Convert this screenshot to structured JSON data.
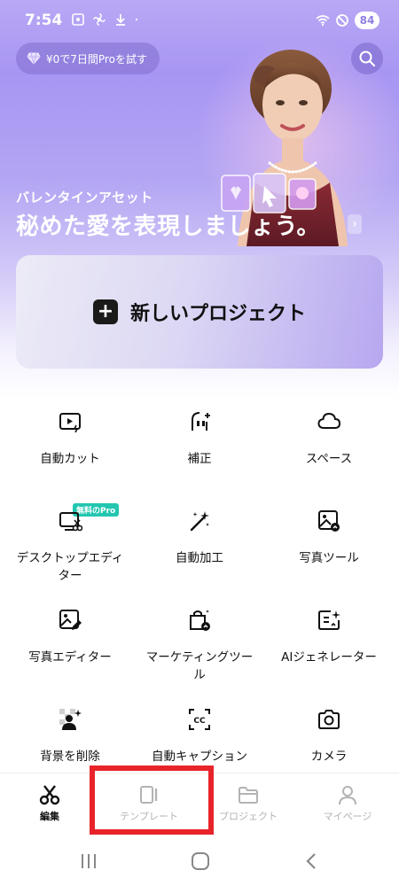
{
  "status_bar": {
    "time": "7:54",
    "battery": "84"
  },
  "promo": {
    "label": "¥0で7日間Proを試す",
    "icon": "diamond-icon"
  },
  "search": {
    "icon": "search-icon"
  },
  "hero": {
    "subtitle": "バレンタインアセット",
    "title": "秘めた愛を表現しましょう。",
    "arrow": "›"
  },
  "new_project": {
    "plus": "+",
    "label": "新しいプロジェクト"
  },
  "tools": [
    {
      "label": "自動カット",
      "icon": "video-auto-icon"
    },
    {
      "label": "補正",
      "icon": "retouch-face-icon"
    },
    {
      "label": "スペース",
      "icon": "cloud-icon"
    },
    {
      "label": "デスクトップエディター",
      "icon": "desktop-scissors-icon",
      "badge": "無料のPro"
    },
    {
      "label": "自動加工",
      "icon": "magic-wand-icon"
    },
    {
      "label": "写真ツール",
      "icon": "photo-tool-icon"
    },
    {
      "label": "写真エディター",
      "icon": "photo-edit-icon"
    },
    {
      "label": "マーケティングツール",
      "icon": "marketing-bag-icon"
    },
    {
      "label": "AIジェネレーター",
      "icon": "ai-generator-icon"
    },
    {
      "label": "背景を削除",
      "icon": "remove-background-icon"
    },
    {
      "label": "自動キャプション",
      "icon": "captions-icon"
    },
    {
      "label": "カメラ",
      "icon": "camera-icon"
    }
  ],
  "bottom_nav": [
    {
      "label": "編集",
      "icon": "scissors-icon",
      "active": true
    },
    {
      "label": "テンプレート",
      "icon": "template-icon",
      "active": false
    },
    {
      "label": "プロジェクト",
      "icon": "folder-icon",
      "active": false
    },
    {
      "label": "マイページ",
      "icon": "person-icon",
      "active": false
    }
  ],
  "colors": {
    "accent": "#a896f3",
    "highlight": "#e8242a",
    "badge": "#23c6b0"
  }
}
